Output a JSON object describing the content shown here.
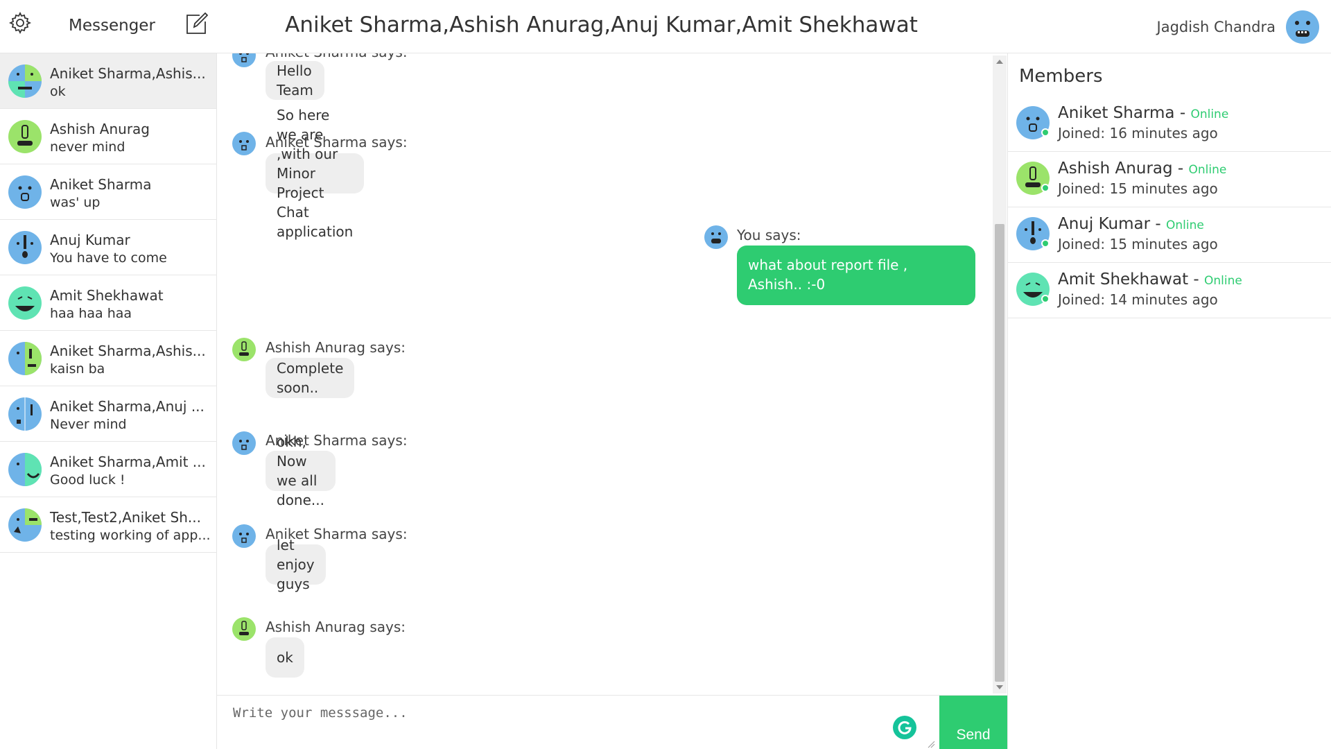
{
  "header": {
    "brand": "Messenger",
    "conversation_title": "Aniket Sharma,Ashish Anurag,Anuj Kumar,Amit Shekhawat",
    "user_name": "Jagdish Chandra"
  },
  "sidebar": {
    "conversations": [
      {
        "name": "Aniket Sharma,Ashis...",
        "preview": "ok"
      },
      {
        "name": "Ashish Anurag",
        "preview": "never mind"
      },
      {
        "name": "Aniket Sharma",
        "preview": "was' up"
      },
      {
        "name": "Anuj Kumar",
        "preview": "You have to come"
      },
      {
        "name": "Amit Shekhawat",
        "preview": "haa haa haa"
      },
      {
        "name": "Aniket Sharma,Ashis...",
        "preview": "kaisn ba"
      },
      {
        "name": "Aniket Sharma,Anuj ...",
        "preview": "Never mind"
      },
      {
        "name": "Aniket Sharma,Amit ...",
        "preview": "Good luck !"
      },
      {
        "name": "Test,Test2,Aniket Sh...",
        "preview": "testing working of app..."
      }
    ]
  },
  "chat": {
    "messages": [
      {
        "sender": "Aniket Sharma says:",
        "text": "Hello Team"
      },
      {
        "sender": "Aniket Sharma says:",
        "text": "So here we are ,with our Minor Project Chat application"
      },
      {
        "sender": "You says:",
        "text": "what about report file , Ashish.. :-0"
      },
      {
        "sender": "Ashish Anurag says:",
        "text": "Complete soon.."
      },
      {
        "sender": "Aniket Sharma says:",
        "text": "okh, Now we all done..."
      },
      {
        "sender": "Aniket Sharma says:",
        "text": "let enjoy guys"
      },
      {
        "sender": "Ashish Anurag says:",
        "text": "ok"
      }
    ]
  },
  "composer": {
    "placeholder": "Write your messsage...",
    "value": "",
    "send_label": "Send"
  },
  "members": {
    "title": "Members",
    "list": [
      {
        "name": "Aniket Sharma",
        "dash": " - ",
        "status": "Online",
        "joined": "Joined: 16 minutes ago"
      },
      {
        "name": "Ashish Anurag",
        "dash": " - ",
        "status": "Online",
        "joined": "Joined: 15 minutes ago"
      },
      {
        "name": "Anuj Kumar",
        "dash": " - ",
        "status": "Online",
        "joined": "Joined: 15 minutes ago"
      },
      {
        "name": "Amit Shekhawat",
        "dash": " - ",
        "status": "Online",
        "joined": "Joined: 14 minutes ago"
      }
    ]
  },
  "colors": {
    "accent": "#2ecc71",
    "avatar_blue": "#6fb3e8",
    "avatar_green": "#9be36a",
    "avatar_teal": "#5fe3b3",
    "bubble_gray": "#eeeeee"
  },
  "icons": {
    "settings": "gear-icon",
    "compose": "compose-icon",
    "grammarly": "grammarly-icon"
  }
}
